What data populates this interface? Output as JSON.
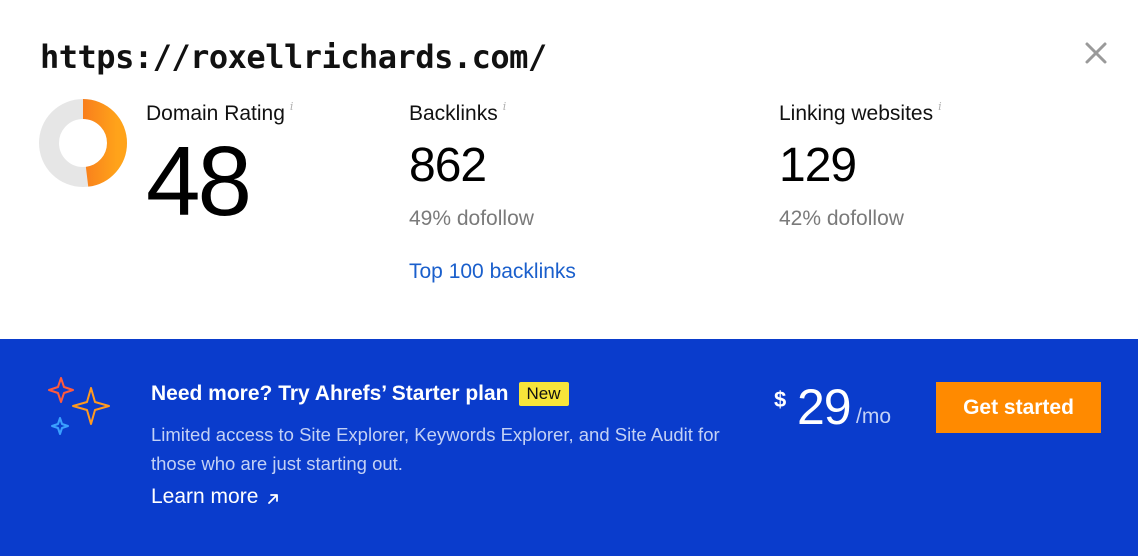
{
  "header": {
    "url": "https://roxellrichards.com/"
  },
  "domain_rating": {
    "label": "Domain Rating",
    "info": "i",
    "value": "48",
    "fraction": 0.48,
    "ring_color": "#f25a1e",
    "ring_color_end": "#ffa31a",
    "track_color": "#e6e6e6"
  },
  "backlinks": {
    "label": "Backlinks",
    "info": "i",
    "value": "862",
    "sub": "49% dofollow",
    "link": "Top 100 backlinks"
  },
  "linking_websites": {
    "label": "Linking websites",
    "info": "i",
    "value": "129",
    "sub": "42% dofollow"
  },
  "promo": {
    "title": "Need more? Try Ahrefs’ Starter plan",
    "badge": "New",
    "description": "Limited access to Site Explorer, Keywords Explorer, and Site Audit for those who are just starting out.",
    "learn_more": "Learn more",
    "price_symbol": "$",
    "price_value": "29",
    "price_period": "/mo",
    "cta": "Get started",
    "background": "#0a3ccc",
    "cta_color": "#ff8a00",
    "badge_color": "#f7e53a"
  },
  "icons": {
    "close": "close-icon",
    "sparkles": "sparkles-icon",
    "arrow": "arrow-up-right-icon"
  }
}
